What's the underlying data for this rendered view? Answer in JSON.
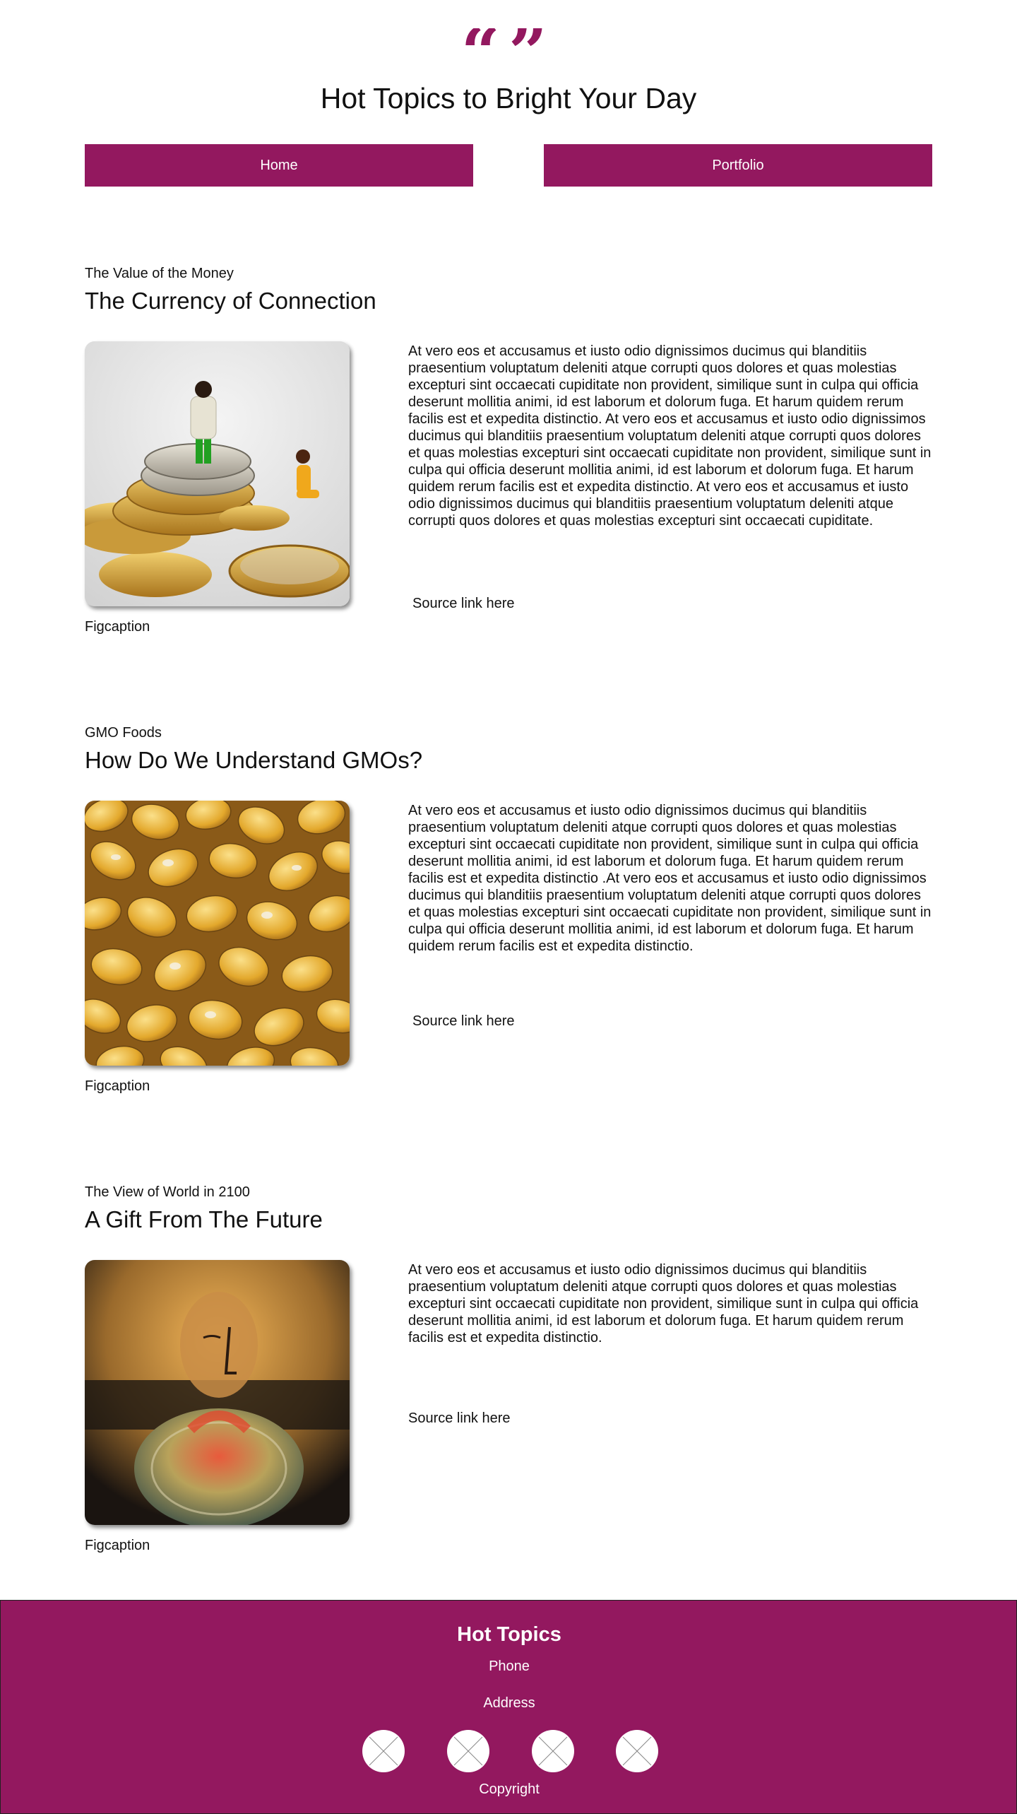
{
  "header": {
    "quote_icon": "quotation-marks-icon",
    "quote_glyph": "“”",
    "title": "Hot Topics to Bright Your Day",
    "accent_color": "#93185f"
  },
  "nav": {
    "home_label": "Home",
    "portfolio_label": "Portfolio"
  },
  "articles": [
    {
      "kicker": "The Value of the Money",
      "headline": "The Currency of Connection",
      "image": "coins-with-miniature-figures-image",
      "body": "At vero eos et accusamus et iusto odio dignissimos ducimus qui blanditiis praesentium voluptatum deleniti atque corrupti quos dolores et quas molestias excepturi sint occaecati cupiditate non provident, similique sunt in culpa qui officia deserunt mollitia animi, id est laborum et dolorum fuga. Et harum quidem rerum facilis est et expedita distinctio. At vero eos et accusamus et iusto odio dignissimos ducimus qui blanditiis praesentium voluptatum deleniti atque corrupti quos dolores et quas molestias excepturi sint occaecati cupiditate non provident, similique sunt in culpa qui officia deserunt mollitia animi, id est laborum et dolorum fuga. Et harum quidem rerum facilis est et expedita distinctio. At vero eos et accusamus et iusto odio dignissimos ducimus qui blanditiis praesentium voluptatum deleniti atque corrupti quos dolores et quas molestias excepturi sint occaecati cupiditate.",
      "source_label": "Source link here",
      "figcaption": "Figcaption"
    },
    {
      "kicker": "GMO Foods",
      "headline": "How Do We Understand GMOs?",
      "image": "corn-kernels-image",
      "body": "At vero eos et accusamus et iusto odio dignissimos ducimus qui blanditiis praesentium voluptatum deleniti atque corrupti quos dolores et quas molestias excepturi sint occaecati cupiditate non provident, similique sunt in culpa qui officia deserunt mollitia animi, id est laborum et dolorum fuga. Et harum quidem rerum facilis est et expedita distinctio .At vero eos et accusamus et iusto odio dignissimos ducimus qui blanditiis praesentium voluptatum deleniti atque corrupti quos dolores et quas molestias excepturi sint occaecati cupiditate non provident, similique sunt in culpa qui officia deserunt mollitia animi, id est laborum et dolorum fuga. Et harum quidem rerum facilis est et expedita distinctio.",
      "source_label": "Source link here",
      "figcaption": "Figcaption"
    },
    {
      "kicker": "The View of World in 2100",
      "headline": "A Gift From The Future",
      "image": "abstract-face-painting-image",
      "body": "At vero eos et accusamus et iusto odio dignissimos ducimus qui blanditiis praesentium voluptatum deleniti atque corrupti quos dolores et quas molestias excepturi sint occaecati cupiditate non provident, similique sunt in culpa qui officia deserunt mollitia animi, id est laborum et dolorum fuga. Et harum quidem rerum facilis est et expedita distinctio.",
      "source_label": "Source link here",
      "figcaption": "Figcaption"
    }
  ],
  "footer": {
    "brand": "Hot Topics",
    "phone": "Phone",
    "address": "Address",
    "social_icons": [
      "social-icon-placeholder",
      "social-icon-placeholder",
      "social-icon-placeholder",
      "social-icon-placeholder"
    ],
    "copyright": "Copyright",
    "background_color": "#93185f"
  }
}
